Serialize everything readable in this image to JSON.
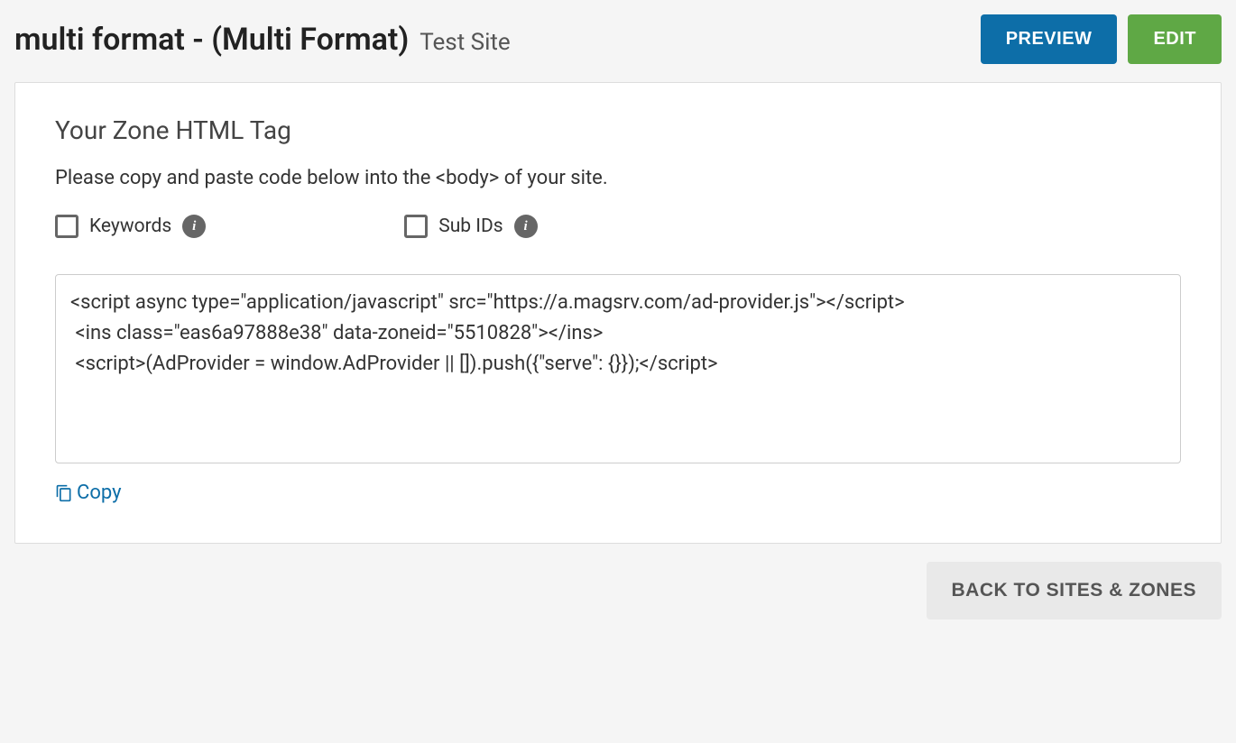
{
  "header": {
    "title": "multi format - (Multi Format)",
    "subtitle": "Test Site",
    "preview_label": "PREVIEW",
    "edit_label": "EDIT"
  },
  "panel": {
    "section_title": "Your Zone HTML Tag",
    "section_desc": "Please copy and paste code below into the <body> of your site.",
    "options": {
      "keywords_label": "Keywords",
      "subids_label": "Sub IDs"
    },
    "code": "<script async type=\"application/javascript\" src=\"https://a.magsrv.com/ad-provider.js\"></script> \n <ins class=\"eas6a97888e38\" data-zoneid=\"5510828\"></ins> \n <script>(AdProvider = window.AdProvider || []).push({\"serve\": {}});</script>",
    "copy_label": "Copy"
  },
  "footer": {
    "back_label": "BACK TO SITES & ZONES"
  }
}
